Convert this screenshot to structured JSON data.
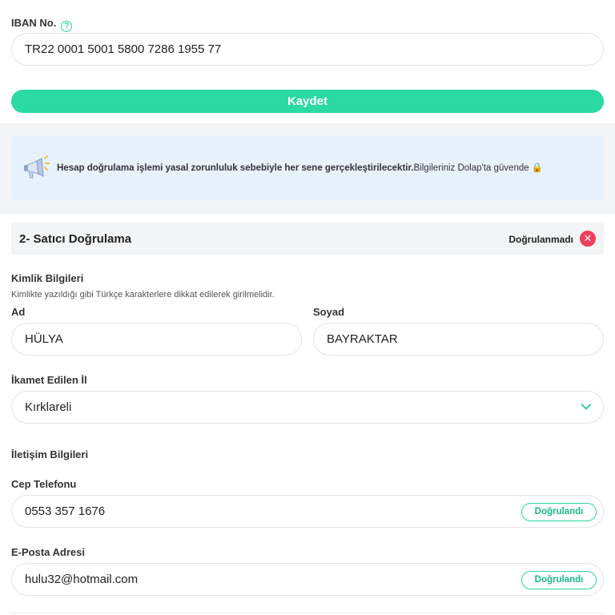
{
  "iban": {
    "label": "IBAN No.",
    "help_icon": "question-circle-icon",
    "value": "TR22 0001 5001 5800 7286 1955 77"
  },
  "save_button": {
    "label": "Kaydet",
    "color": "#2bd9a3"
  },
  "info_banner": {
    "icon": "megaphone-icon",
    "bold_text": "Hesap doğrulama işlemi yasal zorunluluk sebebiyle her sene gerçekleştirilecektir.",
    "regular_text": "Bilgileriniz Dolap'ta güvende 🔒"
  },
  "seller_verification": {
    "title": "2- Satıcı Doğrulama",
    "status": "Doğrulanmadı",
    "status_icon": "close-icon",
    "status_color": "#ef3f5c"
  },
  "identity": {
    "title": "Kimlik Bilgileri",
    "hint": "Kimlikte yazıldığı gibi Türkçe karakterlere dikkat edilerek girilmelidir.",
    "first_name_label": "Ad",
    "first_name_value": "HÜLYA",
    "last_name_label": "Soyad",
    "last_name_value": "BAYRAKTAR",
    "city_label": "İkamet Edilen İl",
    "city_value": "Kırklareli",
    "city_icon": "chevron-down-icon"
  },
  "contact": {
    "title": "İletişim Bilgileri",
    "phone_label": "Cep Telefonu",
    "phone_value": "0553 357 1676",
    "phone_status": "Doğrulandı",
    "email_label": "E-Posta Adresi",
    "email_value": "hulu32@hotmail.com",
    "email_status": "Doğrulandı",
    "accent_color": "#2bd4a0"
  }
}
